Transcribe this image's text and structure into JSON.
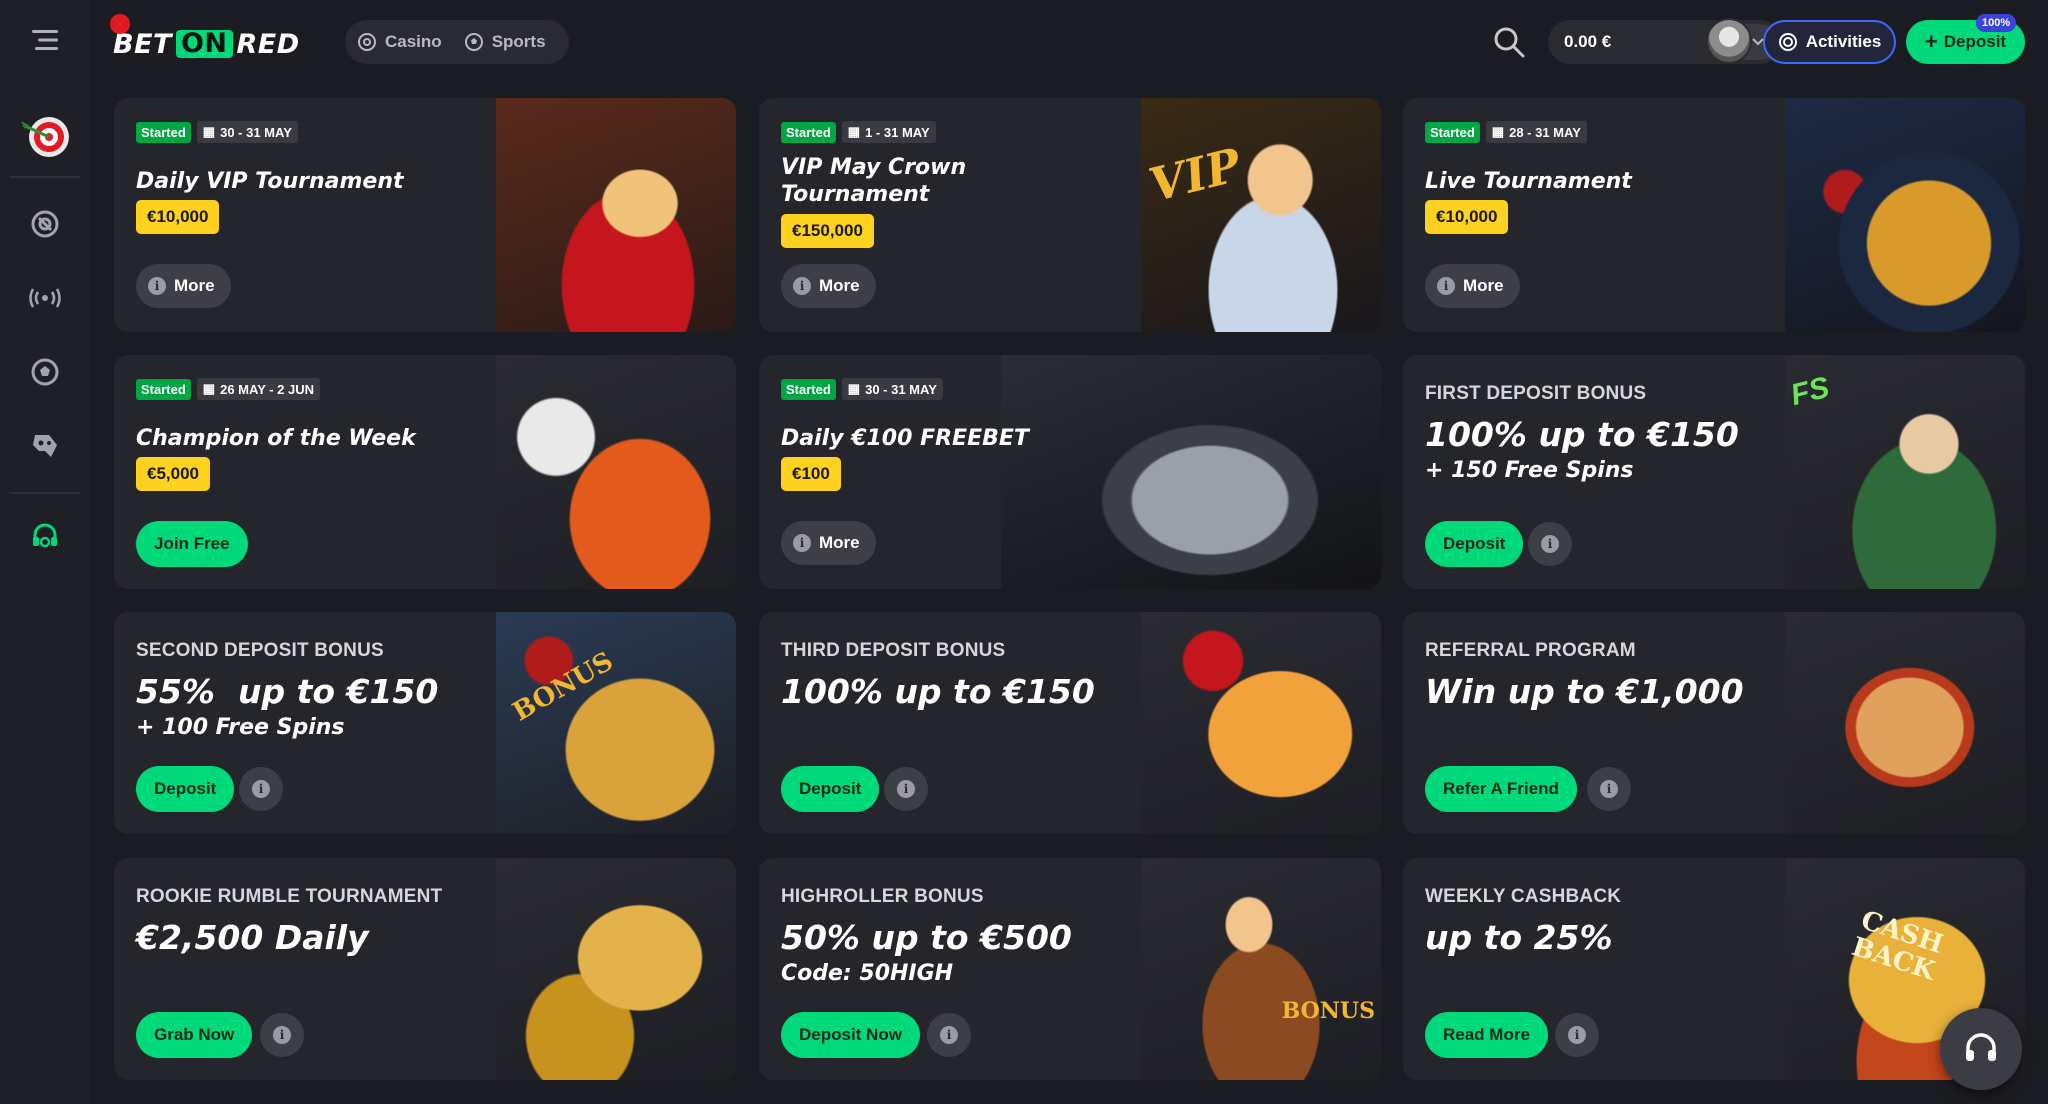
{
  "header": {
    "logo": {
      "bet": "BET",
      "on": "ON",
      "red": "RED"
    },
    "nav": [
      {
        "label": "Casino",
        "icon": "casino-chip-icon"
      },
      {
        "label": "Sports",
        "icon": "soccer-ball-icon"
      }
    ],
    "balance": "0.00 €",
    "activities_label": "Activities",
    "deposit_label": "Deposit",
    "deposit_badge": "100%",
    "accent": "#00d97a"
  },
  "sidebar": {
    "icons": [
      "menu-icon",
      "dart-target-icon",
      "casino-chip-icon",
      "live-broadcast-icon",
      "soccer-ball-icon",
      "gamepad-icon",
      "support-headset-icon"
    ]
  },
  "cards": [
    {
      "status": "Started",
      "dates": "30 - 31 MAY",
      "title": "Daily VIP Tournament",
      "prize": "€10,000",
      "button": "More"
    },
    {
      "status": "Started",
      "dates": "1 - 31 MAY",
      "title_line1": "VIP May Crown",
      "title_line2": "Tournament",
      "prize": "€150,000",
      "button": "More"
    },
    {
      "status": "Started",
      "dates": "28 - 31 MAY",
      "title": "Live Tournament",
      "prize": "€10,000",
      "button": "More"
    },
    {
      "status": "Started",
      "dates": "26 MAY - 2 JUN",
      "title": "Champion of the Week",
      "prize": "€5,000",
      "button": "Join Free"
    },
    {
      "status": "Started",
      "dates": "30 - 31 MAY",
      "title": "Daily €100 FREEBET",
      "prize": "€100",
      "button": "More"
    },
    {
      "kicker": "FIRST DEPOSIT BONUS",
      "headline": "100% up to €150",
      "sub": "+ 150 Free Spins",
      "button": "Deposit"
    },
    {
      "kicker": "SECOND DEPOSIT BONUS",
      "headline": "55%  up to €150",
      "sub": "+ 100 Free Spins",
      "button": "Deposit"
    },
    {
      "kicker": "THIRD DEPOSIT BONUS",
      "headline": "100% up to €150",
      "button": "Deposit"
    },
    {
      "kicker": "REFERRAL PROGRAM",
      "headline": "Win up to €1,000",
      "button": "Refer A Friend"
    },
    {
      "kicker": "ROOKIE RUMBLE TOURNAMENT",
      "headline": "€2,500 Daily",
      "button": "Grab Now"
    },
    {
      "kicker": "HIGHROLLER BONUS",
      "headline": "50% up to €500",
      "sub": "Code: 50HIGH",
      "button": "Deposit Now"
    },
    {
      "kicker": "WEEKLY CASHBACK",
      "headline": "up to 25%",
      "button": "Read More"
    }
  ],
  "art": {
    "vip_word": "VIP",
    "fs_word": "FS",
    "bonus_word": "BONUS",
    "cash_word": "CASH",
    "back_word": "BACK"
  }
}
